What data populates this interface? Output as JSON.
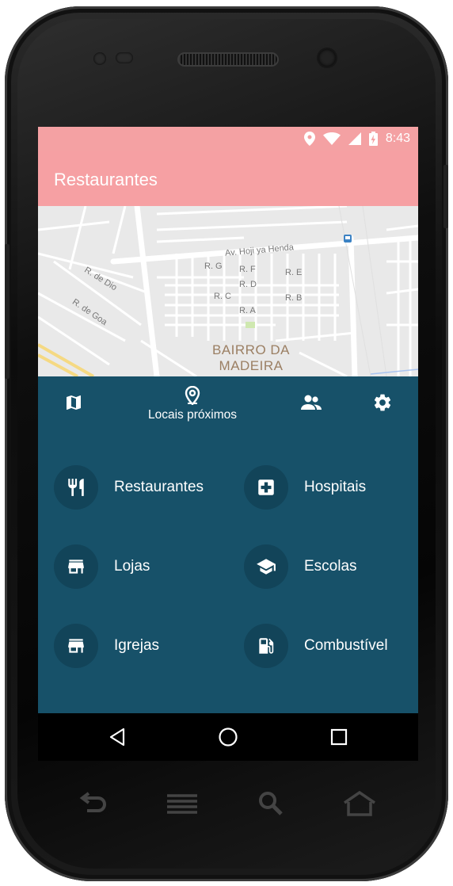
{
  "status_bar": {
    "time": "8:43",
    "icons": [
      "location-icon",
      "wifi-icon",
      "signal-icon",
      "battery-charging-icon"
    ]
  },
  "app_bar": {
    "title": "Restaurantes"
  },
  "map": {
    "street_labels": [
      "Av. Hoji ya Henda",
      "R. G",
      "R. F",
      "R. E",
      "R. D",
      "R. C",
      "R. B",
      "R. A",
      "R. de Dio",
      "R. de Goa"
    ],
    "district_line1": "BAIRRO DA",
    "district_line2": "MADEIRA"
  },
  "nav": {
    "items": [
      {
        "icon": "map-icon",
        "label": ""
      },
      {
        "icon": "place-pin-icon",
        "label": "Locais próximos"
      },
      {
        "icon": "people-icon",
        "label": ""
      },
      {
        "icon": "gear-icon",
        "label": ""
      }
    ]
  },
  "categories": [
    {
      "icon": "fork-knife-icon",
      "label": "Restaurantes"
    },
    {
      "icon": "hospital-cross-icon",
      "label": "Hospitais"
    },
    {
      "icon": "store-icon",
      "label": "Lojas"
    },
    {
      "icon": "graduation-cap-icon",
      "label": "Escolas"
    },
    {
      "icon": "store-icon",
      "label": "Igrejas"
    },
    {
      "icon": "fuel-pump-icon",
      "label": "Combustível"
    }
  ],
  "android_nav": [
    "back-icon",
    "home-icon",
    "recents-icon"
  ],
  "hardware_buttons": [
    "back-icon",
    "menu-icon",
    "search-icon",
    "home-icon"
  ],
  "colors": {
    "app_bar": "#f6a0a3",
    "panel": "#175169",
    "icon_circle": "#124459",
    "district_text": "#9b7f63"
  }
}
